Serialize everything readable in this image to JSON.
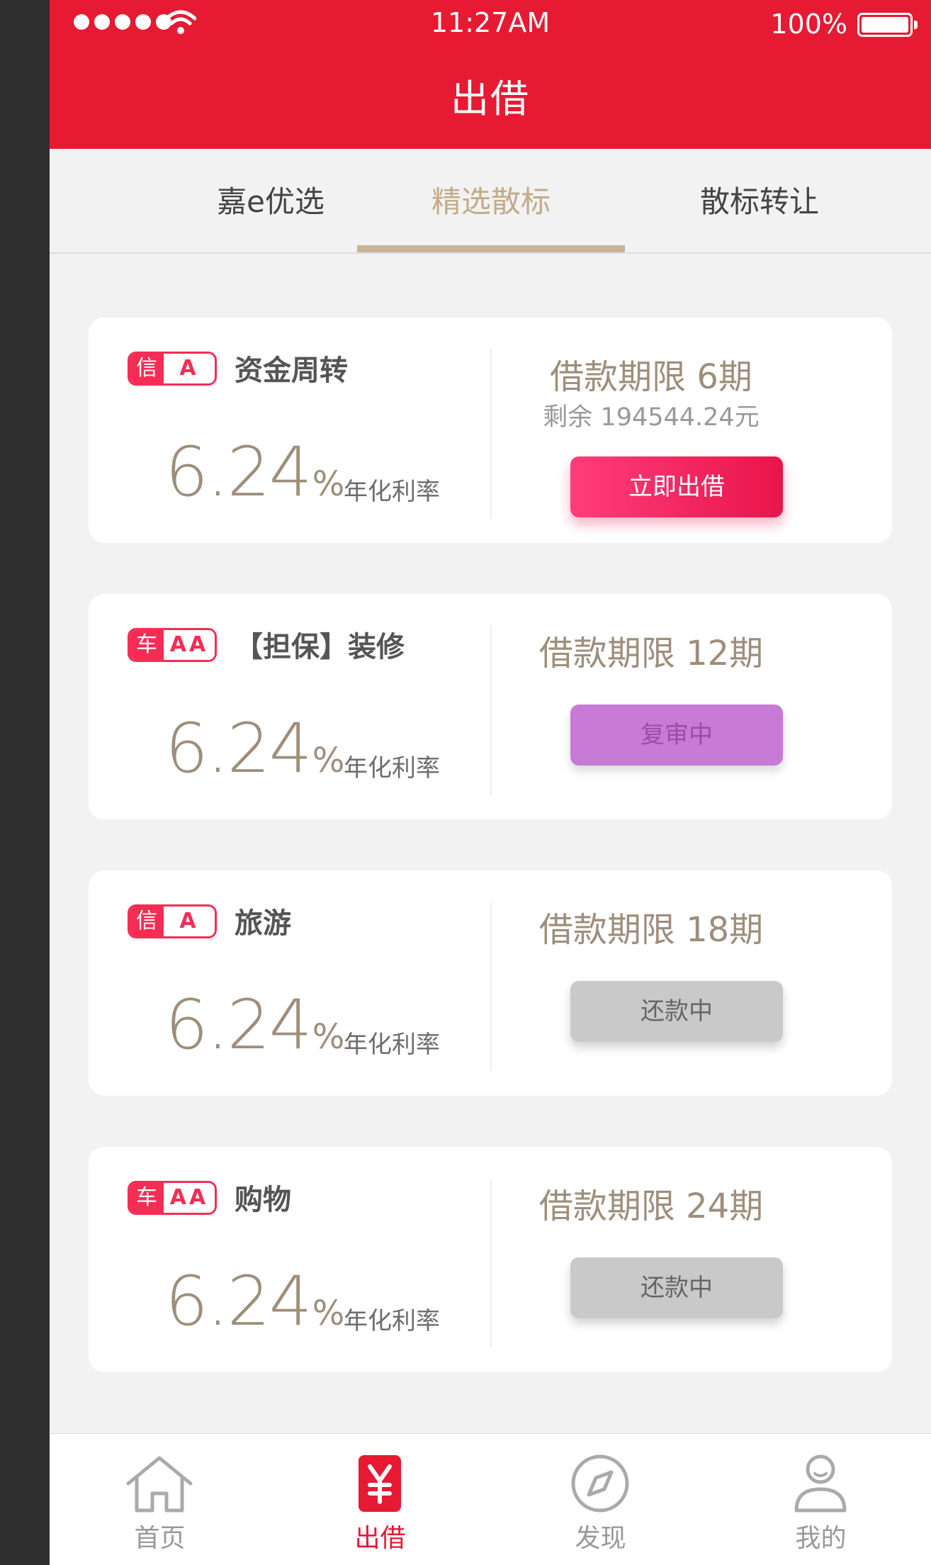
{
  "status_bar": {
    "time": "11:27AM",
    "battery": "100%"
  },
  "nav": {
    "title": "出借"
  },
  "tabs": [
    {
      "label": "嘉e优选"
    },
    {
      "label": "精选散标"
    },
    {
      "label": "散标转让"
    }
  ],
  "active_tab": "精选散标",
  "colors": {
    "brand": "#e61a33",
    "accent_gold": "#c2ab8a",
    "badge": "#f52d55",
    "invest_button": "#f0285a"
  },
  "cards": [
    {
      "badge_type": "信",
      "badge_grade": "A",
      "title": "资金周转",
      "rate": "6.24",
      "rate_unit": "%",
      "rate_label": "年化利率",
      "term": "借款期限  6期",
      "remaining": "剩余 194544.24元",
      "button": "立即出借"
    },
    {
      "badge_type": "车",
      "badge_grade": "AA",
      "title": "【担保】装修",
      "rate": "6.24",
      "rate_unit": "%",
      "rate_label": "年化利率",
      "term": "借款期限  12期",
      "button": "复审中"
    },
    {
      "badge_type": "信",
      "badge_grade": "A",
      "title": "旅游",
      "rate": "6.24",
      "rate_unit": "%",
      "rate_label": "年化利率",
      "term": "借款期限  18期",
      "button": "还款中"
    },
    {
      "badge_type": "车",
      "badge_grade": "AA",
      "title": "购物",
      "rate": "6.24",
      "rate_unit": "%",
      "rate_label": "年化利率",
      "term": "借款期限  24期",
      "button": "还款中"
    }
  ],
  "tabbar": [
    {
      "label": "首页",
      "icon": "home-icon"
    },
    {
      "label": "出借",
      "icon": "yuan-icon"
    },
    {
      "label": "发现",
      "icon": "compass-icon"
    },
    {
      "label": "我的",
      "icon": "user-icon"
    }
  ]
}
